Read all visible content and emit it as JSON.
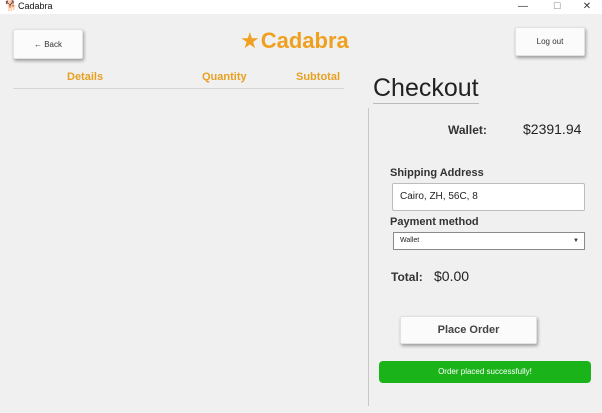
{
  "window": {
    "title": "Cadabra",
    "app_icon": "cadabra-app-icon",
    "minimize_glyph": "—",
    "maximize_glyph": "☐",
    "close_glyph": "✕"
  },
  "header": {
    "back_label": "← Back",
    "brand_star": "★",
    "brand_name": "Cadabra",
    "logout_label": "Log out"
  },
  "cart_table": {
    "columns": [
      "Details",
      "Quantity",
      "Subtotal"
    ],
    "rows": []
  },
  "checkout": {
    "title": "Checkout",
    "wallet_label": "Wallet:",
    "wallet_value": "$2391.94",
    "shipping_label": "Shipping Address",
    "shipping_value": "Cairo, ZH, 56C, 8",
    "payment_label": "Payment method",
    "payment_selected": "Wallet",
    "total_label": "Total:",
    "total_value": "$0.00",
    "place_order_label": "Place Order",
    "status_message": "Order placed successfully!"
  },
  "colors": {
    "brand": "#f0a020",
    "success": "#1ab41a",
    "background": "#f0f0f0"
  }
}
